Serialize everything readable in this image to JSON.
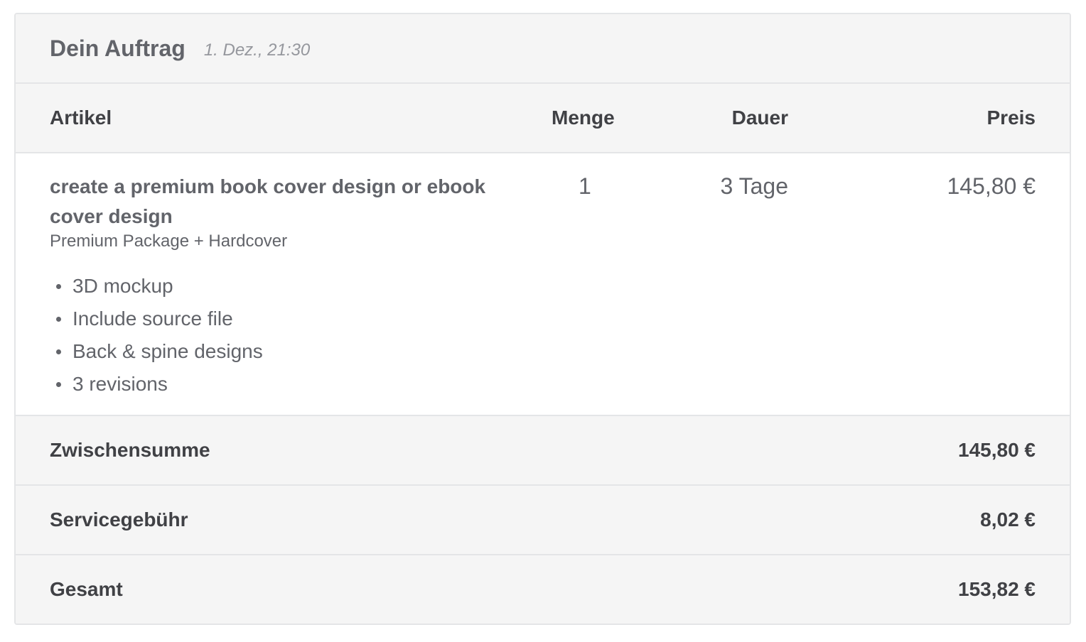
{
  "order": {
    "title": "Dein Auftrag",
    "date": "1. Dez., 21:30"
  },
  "columns": {
    "item": "Artikel",
    "quantity": "Menge",
    "duration": "Dauer",
    "price": "Preis"
  },
  "item": {
    "name": "create a premium book cover design or ebook cover design",
    "package": "Premium Package + Hardcover",
    "features": [
      "3D mockup",
      "Include source file",
      "Back & spine designs",
      "3 revisions"
    ],
    "quantity": "1",
    "duration": "3 Tage",
    "price": "145,80 €"
  },
  "summary": {
    "subtotal_label": "Zwischensumme",
    "subtotal_value": "145,80 €",
    "fee_label": "Servicegebühr",
    "fee_value": "8,02 €",
    "total_label": "Gesamt",
    "total_value": "153,82 €"
  },
  "colors": {
    "header_bg": "#f5f5f5",
    "border": "#e4e5e7",
    "text_dark": "#404145",
    "text_muted": "#62646a"
  }
}
